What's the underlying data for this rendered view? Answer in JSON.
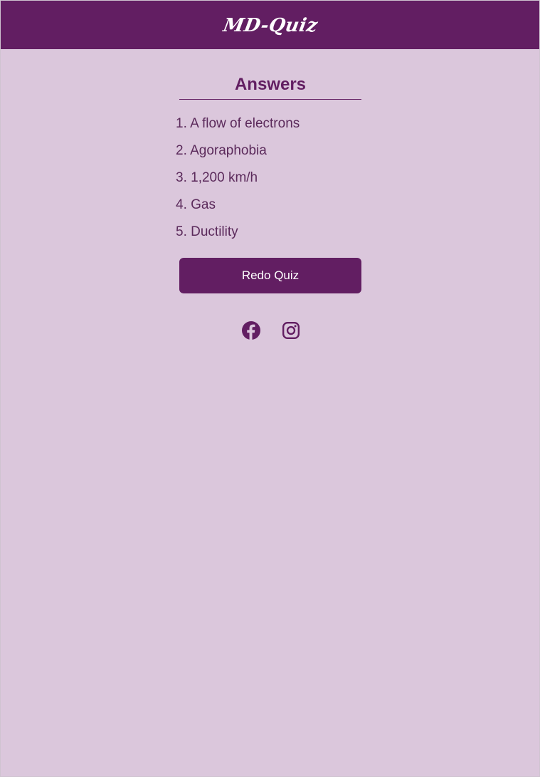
{
  "header": {
    "logo_text": "MD-Quiz"
  },
  "main": {
    "title": "Answers",
    "answers": [
      "1. A flow of electrons",
      "2. Agoraphobia",
      "3. 1,200 km/h",
      "4. Gas",
      "5. Ductility"
    ],
    "redo_button_label": "Redo Quiz"
  },
  "footer": {
    "social_icons": [
      "facebook-icon",
      "instagram-icon"
    ]
  },
  "colors": {
    "brand": "#621e62",
    "background": "#dbc7dc",
    "text": "#5b2a5b"
  }
}
